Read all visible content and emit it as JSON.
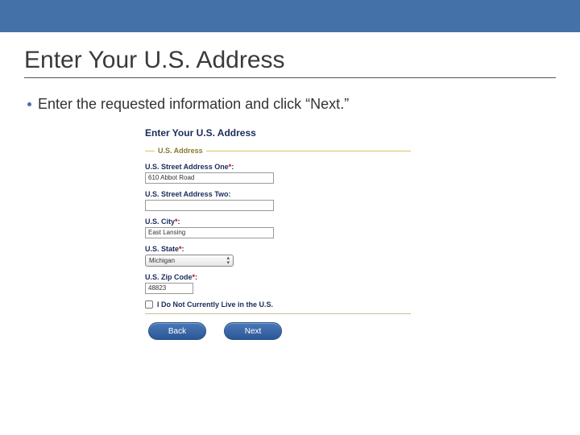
{
  "slide": {
    "title": "Enter Your U.S. Address",
    "bullet": "Enter the requested information and click “Next.”"
  },
  "form": {
    "heading": "Enter Your U.S. Address",
    "section": "U.S. Address",
    "addr1_label": "U.S. Street Address One",
    "addr1_value": "610 Abbot Road",
    "addr2_label": "U.S. Street Address Two:",
    "addr2_value": "",
    "city_label": "U.S. City",
    "city_value": "East Lansing",
    "state_label": "U.S. State",
    "state_value": "Michigan",
    "zip_label": "U.S. Zip Code",
    "zip_value": "48823",
    "nolive_label": "I Do Not Currently Live in the U.S.",
    "back_label": "Back",
    "next_label": "Next",
    "asterisk": "*",
    "colon": ":"
  }
}
